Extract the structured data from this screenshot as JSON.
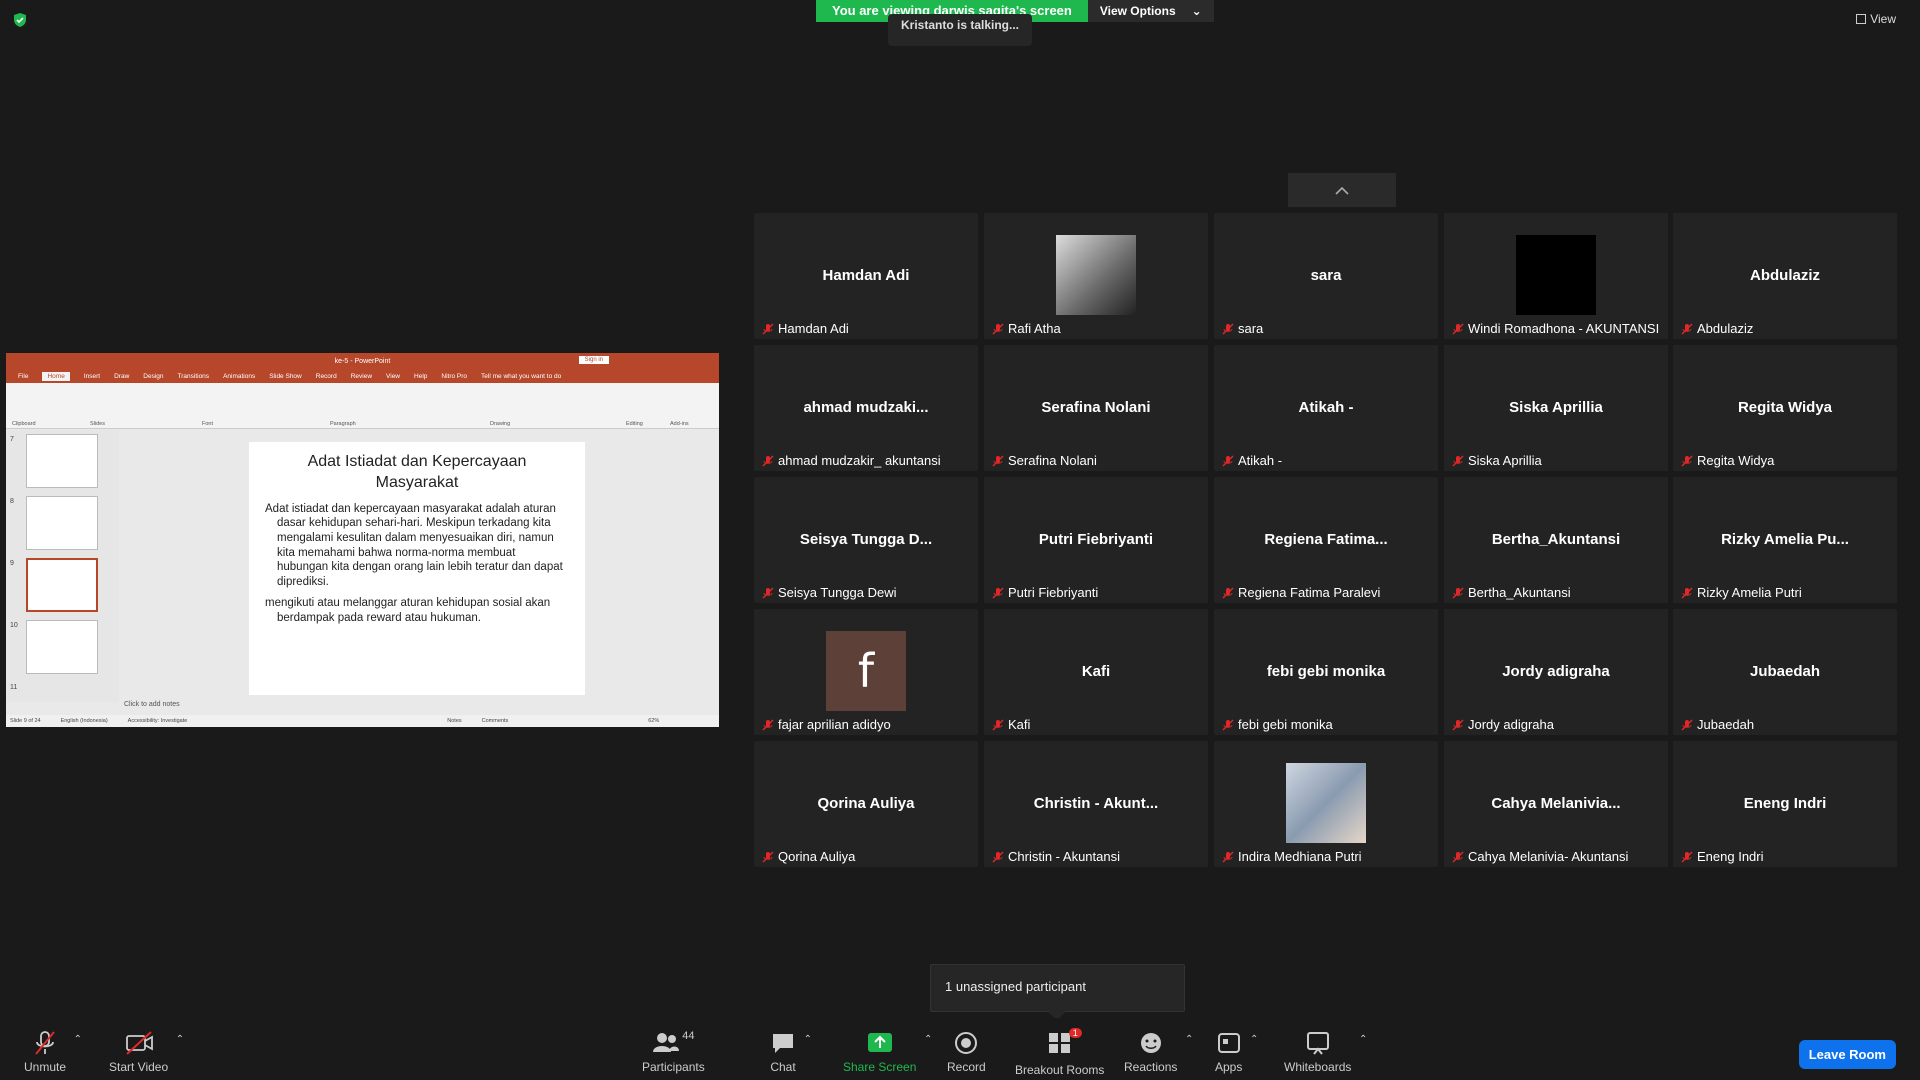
{
  "banner": {
    "viewing": "You are viewing darwis sagita's screen",
    "view_options": "View Options"
  },
  "talking": "Kristanto is talking...",
  "view_button": "View",
  "ppt": {
    "window_title": "ke-5  -  PowerPoint",
    "signin": "Sign in",
    "tabs": [
      "File",
      "Home",
      "Insert",
      "Draw",
      "Design",
      "Transitions",
      "Animations",
      "Slide Show",
      "Record",
      "Review",
      "View",
      "Help",
      "Nitro Pro",
      "Tell me what you want to do"
    ],
    "groups": [
      "Clipboard",
      "Slides",
      "Font",
      "Paragraph",
      "Drawing",
      "Editing",
      "Add-ins"
    ],
    "thumb_numbers": [
      "7",
      "8",
      "9",
      "10",
      "11"
    ],
    "slide_title": "Adat Istiadat dan Kepercayaan Masyarakat",
    "slide_p1": "Adat istiadat dan kepercayaan masyarakat adalah aturan dasar kehidupan sehari-hari. Meskipun terkadang kita mengalami kesulitan dalam menyesuaikan diri, namun kita memahami bahwa norma-norma membuat hubungan kita dengan orang lain lebih teratur dan dapat diprediksi.",
    "slide_p2": "mengikuti atau melanggar aturan kehidupan sosial akan berdampak pada reward atau hukuman.",
    "notes": "Click to add notes",
    "status_slide": "Slide 9 of 24",
    "status_lang": "English (Indonesia)",
    "status_access": "Accessibility: Investigate",
    "status_notes": "Notes",
    "status_comments": "Comments",
    "zoom": "62%"
  },
  "tiles": [
    {
      "big": "Hamdan Adi",
      "label": "Hamdan Adi"
    },
    {
      "big": "",
      "label": "Rafi Atha",
      "photo": "gray"
    },
    {
      "big": "sara",
      "label": "sara"
    },
    {
      "big": "",
      "label": "Windi Romadhona - AKUNTANSI",
      "photo": "black"
    },
    {
      "big": "Abdulaziz",
      "label": "Abdulaziz"
    },
    {
      "big": "ahmad  mudzaki...",
      "label": "ahmad mudzakir_ akuntansi"
    },
    {
      "big": "Serafina Nolani",
      "label": "Serafina Nolani"
    },
    {
      "big": "Atikah -",
      "label": "Atikah -"
    },
    {
      "big": "Siska Aprillia",
      "label": "Siska Aprillia"
    },
    {
      "big": "Regita Widya",
      "label": "Regita Widya"
    },
    {
      "big": "Seisya  Tungga  D...",
      "label": "Seisya Tungga Dewi"
    },
    {
      "big": "Putri Fiebriyanti",
      "label": "Putri Fiebriyanti"
    },
    {
      "big": "Regiena  Fatima...",
      "label": "Regiena Fatima Paralevi"
    },
    {
      "big": "Bertha_Akuntansi",
      "label": "Bertha_Akuntansi"
    },
    {
      "big": "Rizky  Amelia  Pu...",
      "label": "Rizky Amelia Putri"
    },
    {
      "big": "",
      "label": "fajar aprilian adidyo",
      "photo": "f"
    },
    {
      "big": "Kafi",
      "label": "Kafi"
    },
    {
      "big": "febi gebi monika",
      "label": "febi gebi monika"
    },
    {
      "big": "Jordy adigraha",
      "label": "Jordy adigraha"
    },
    {
      "big": "Jubaedah",
      "label": "Jubaedah"
    },
    {
      "big": "Qorina Auliya",
      "label": "Qorina Auliya"
    },
    {
      "big": "Christin  - Akunt...",
      "label": "Christin  - Akuntansi"
    },
    {
      "big": "",
      "label": "Indira Medhiana Putri",
      "photo": "blue"
    },
    {
      "big": "Cahya  Melanivia...",
      "label": "Cahya Melanivia- Akuntansi"
    },
    {
      "big": "Eneng Indri",
      "label": "Eneng Indri"
    }
  ],
  "toast": "1 unassigned participant",
  "toolbar": {
    "unmute": "Unmute",
    "start_video": "Start Video",
    "participants": "Participants",
    "participants_count": "44",
    "chat": "Chat",
    "share_screen": "Share Screen",
    "record": "Record",
    "breakout": "Breakout Rooms",
    "breakout_badge": "1",
    "reactions": "Reactions",
    "apps": "Apps",
    "whiteboards": "Whiteboards",
    "leave": "Leave Room"
  },
  "colors": {
    "accent_green": "#1fb84f",
    "leave_blue": "#0e72ed",
    "muted_red": "#e02828",
    "ppt_red": "#b7472a"
  }
}
